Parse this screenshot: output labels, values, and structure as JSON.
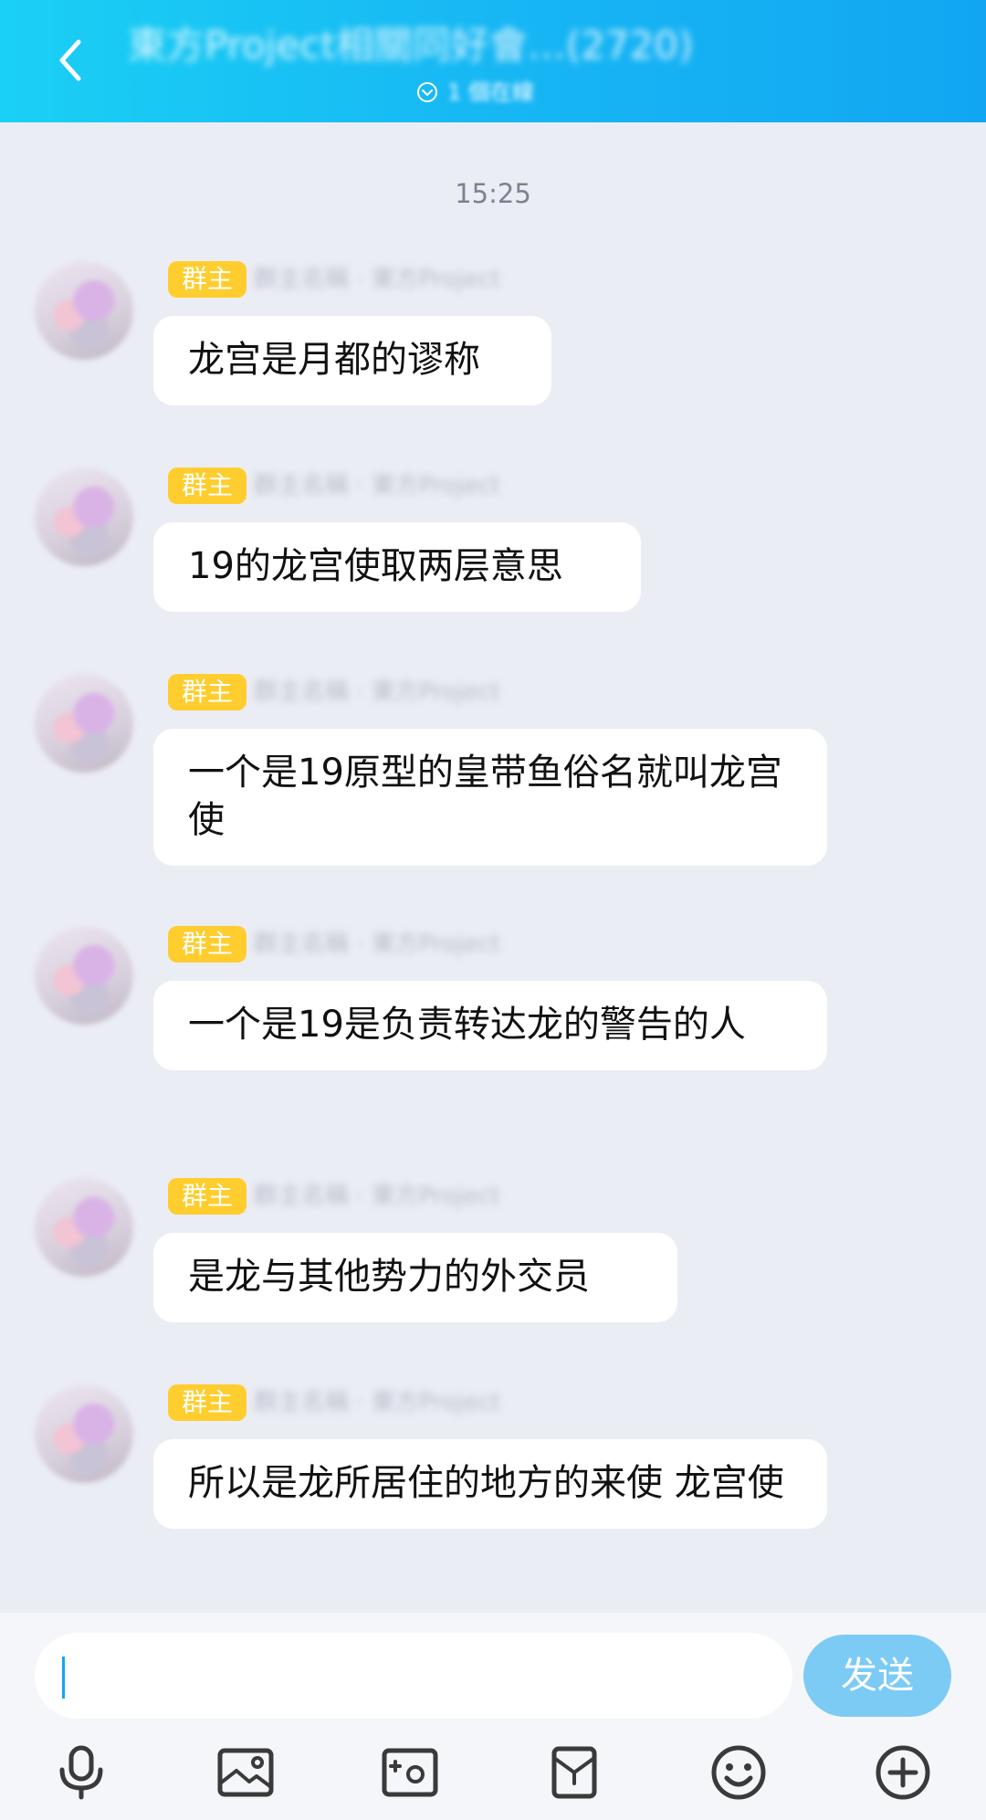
{
  "header": {
    "title": "東方Project相關同好會…(2720)",
    "subtitle": "1 個在線"
  },
  "chat": {
    "timestamp": "15:25",
    "messages": [
      {
        "badge": "群主",
        "sender": "群主名稱 · 東方Project",
        "text": "龙宫是月都的谬称"
      },
      {
        "badge": "群主",
        "sender": "群主名稱 · 東方Project",
        "text": "19的龙宫使取两层意思"
      },
      {
        "badge": "群主",
        "sender": "群主名稱 · 東方Project",
        "text": "一个是19原型的皇带鱼俗名就叫龙宫使"
      },
      {
        "badge": "群主",
        "sender": "群主名稱 · 東方Project",
        "text": "一个是19是负责转达龙的警告的人"
      },
      {
        "badge": "群主",
        "sender": "群主名稱 · 東方Project",
        "text": "是龙与其他势力的外交员"
      },
      {
        "badge": "群主",
        "sender": "群主名稱 · 東方Project",
        "text": "所以是龙所居住的地方的来使 龙宫使"
      }
    ]
  },
  "input": {
    "value": "",
    "send_label": "发送"
  },
  "toolbar": {
    "icons": [
      "microphone-icon",
      "image-icon",
      "camera-icon",
      "red-packet-icon",
      "emoji-icon",
      "plus-icon"
    ]
  },
  "colors": {
    "header_gradient_start": "#1ad0f4",
    "header_gradient_end": "#12a6f2",
    "badge": "#ffcd2e",
    "send_button": "#7ccbf5",
    "chat_background": "#ebedf5"
  }
}
